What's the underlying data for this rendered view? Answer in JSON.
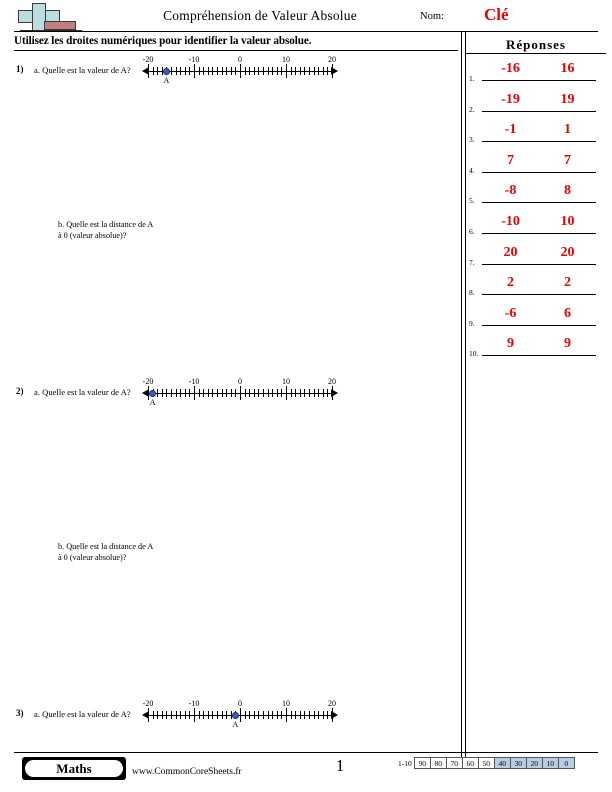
{
  "header": {
    "title": "Compréhension de Valeur Absolue",
    "name_label": "Nom:",
    "name_value": "Clé",
    "logo_icon": "plus-block-logo"
  },
  "instruction": "Utilisez les droites numériques pour identifier la valeur absolue.",
  "answers": {
    "title": "Réponses",
    "rows": [
      {
        "num": "1.",
        "value": "-16",
        "absolute": "16"
      },
      {
        "num": "2.",
        "value": "-19",
        "absolute": "19"
      },
      {
        "num": "3.",
        "value": "-1",
        "absolute": "1"
      },
      {
        "num": "4.",
        "value": "7",
        "absolute": "7"
      },
      {
        "num": "5.",
        "value": "-8",
        "absolute": "8"
      },
      {
        "num": "6.",
        "value": "-10",
        "absolute": "10"
      },
      {
        "num": "7.",
        "value": "20",
        "absolute": "20"
      },
      {
        "num": "8.",
        "value": "2",
        "absolute": "2"
      },
      {
        "num": "9.",
        "value": "-6",
        "absolute": "6"
      },
      {
        "num": "10.",
        "value": "9",
        "absolute": "9"
      }
    ]
  },
  "problems": [
    {
      "num": "1)",
      "part_a": "a. Quelle est la valeur de A?",
      "part_b_line1": "b. Quelle est la distance de A",
      "part_b_line2": "à 0 (valeur absolue)?",
      "numberline": {
        "min": -20,
        "max": 20,
        "labels": [
          "-20",
          "-10",
          "0",
          "10",
          "20"
        ],
        "label_values": [
          -20,
          -10,
          0,
          10,
          20
        ],
        "point_label": "A",
        "point_value": -16
      }
    },
    {
      "num": "2)",
      "part_a": "a. Quelle est la valeur de A?",
      "part_b_line1": "b. Quelle est la distance de A",
      "part_b_line2": "à 0 (valeur absolue)?",
      "numberline": {
        "min": -20,
        "max": 20,
        "labels": [
          "-20",
          "-10",
          "0",
          "10",
          "20"
        ],
        "label_values": [
          -20,
          -10,
          0,
          10,
          20
        ],
        "point_label": "A",
        "point_value": -19
      }
    },
    {
      "num": "3)",
      "part_a": "a. Quelle est la valeur de A?",
      "part_b_line1": "",
      "part_b_line2": "",
      "numberline": {
        "min": -20,
        "max": 20,
        "labels": [
          "-20",
          "-10",
          "0",
          "10",
          "20"
        ],
        "label_values": [
          -20,
          -10,
          0,
          10,
          20
        ],
        "point_label": "A",
        "point_value": -1
      }
    }
  ],
  "footer": {
    "badge": "Maths",
    "url": "www.CommonCoreSheets.fr",
    "page_number": "1",
    "scale_label": "1-10",
    "scale_values": [
      "90",
      "80",
      "70",
      "60",
      "50",
      "40",
      "30",
      "20",
      "10",
      "0"
    ],
    "scale_highlighted": [
      "40",
      "30",
      "20",
      "10",
      "0"
    ],
    "highlight_color": "#b8cce4"
  }
}
